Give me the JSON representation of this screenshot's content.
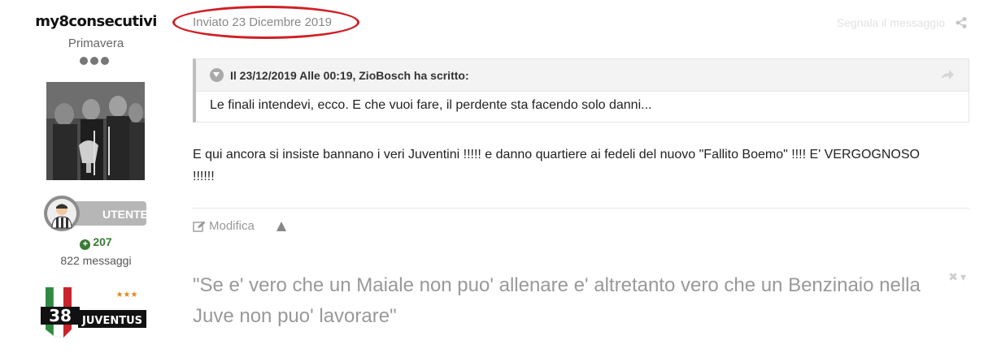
{
  "author": {
    "username": "my8consecutivi",
    "rank_title": "Primavera",
    "rank_pips": 3,
    "avatar": "avatar-photo",
    "badge_label": "UTENTE",
    "reputation": "207",
    "message_count": "822 messaggi",
    "team_logo": {
      "number": "38",
      "name": "JUVENTUS",
      "stars": "★★★"
    }
  },
  "post": {
    "date": "Inviato 23 Dicembre 2019",
    "report_label": "Segnala il messaggio",
    "share_icon": "share-icon",
    "quote": {
      "citation": "Il 23/12/2019 Alle 00:19, ZioBosch ha scritto:",
      "text": "Le finali intendevi, ecco. E che vuoi fare, il perdente sta facendo solo danni..."
    },
    "body": "E qui ancora si insiste bannano i veri Juventini !!!!! e danno quartiere ai fedeli del nuovo \"Fallito Boemo\" !!!! E' VERGOGNOSO !!!!!!",
    "edit_label": "Modifica",
    "vote_icon": "vote-up-icon",
    "signature": "\"Se e' vero che un Maiale non puo' allenare e' altretanto vero che un Benzinaio nella Juve non puo' lavorare\"",
    "signature_controls": [
      "✖",
      "▾"
    ]
  },
  "colors": {
    "annotation": "#d01f25",
    "reputation": "#3a7a34",
    "muted_text": "#999999"
  }
}
